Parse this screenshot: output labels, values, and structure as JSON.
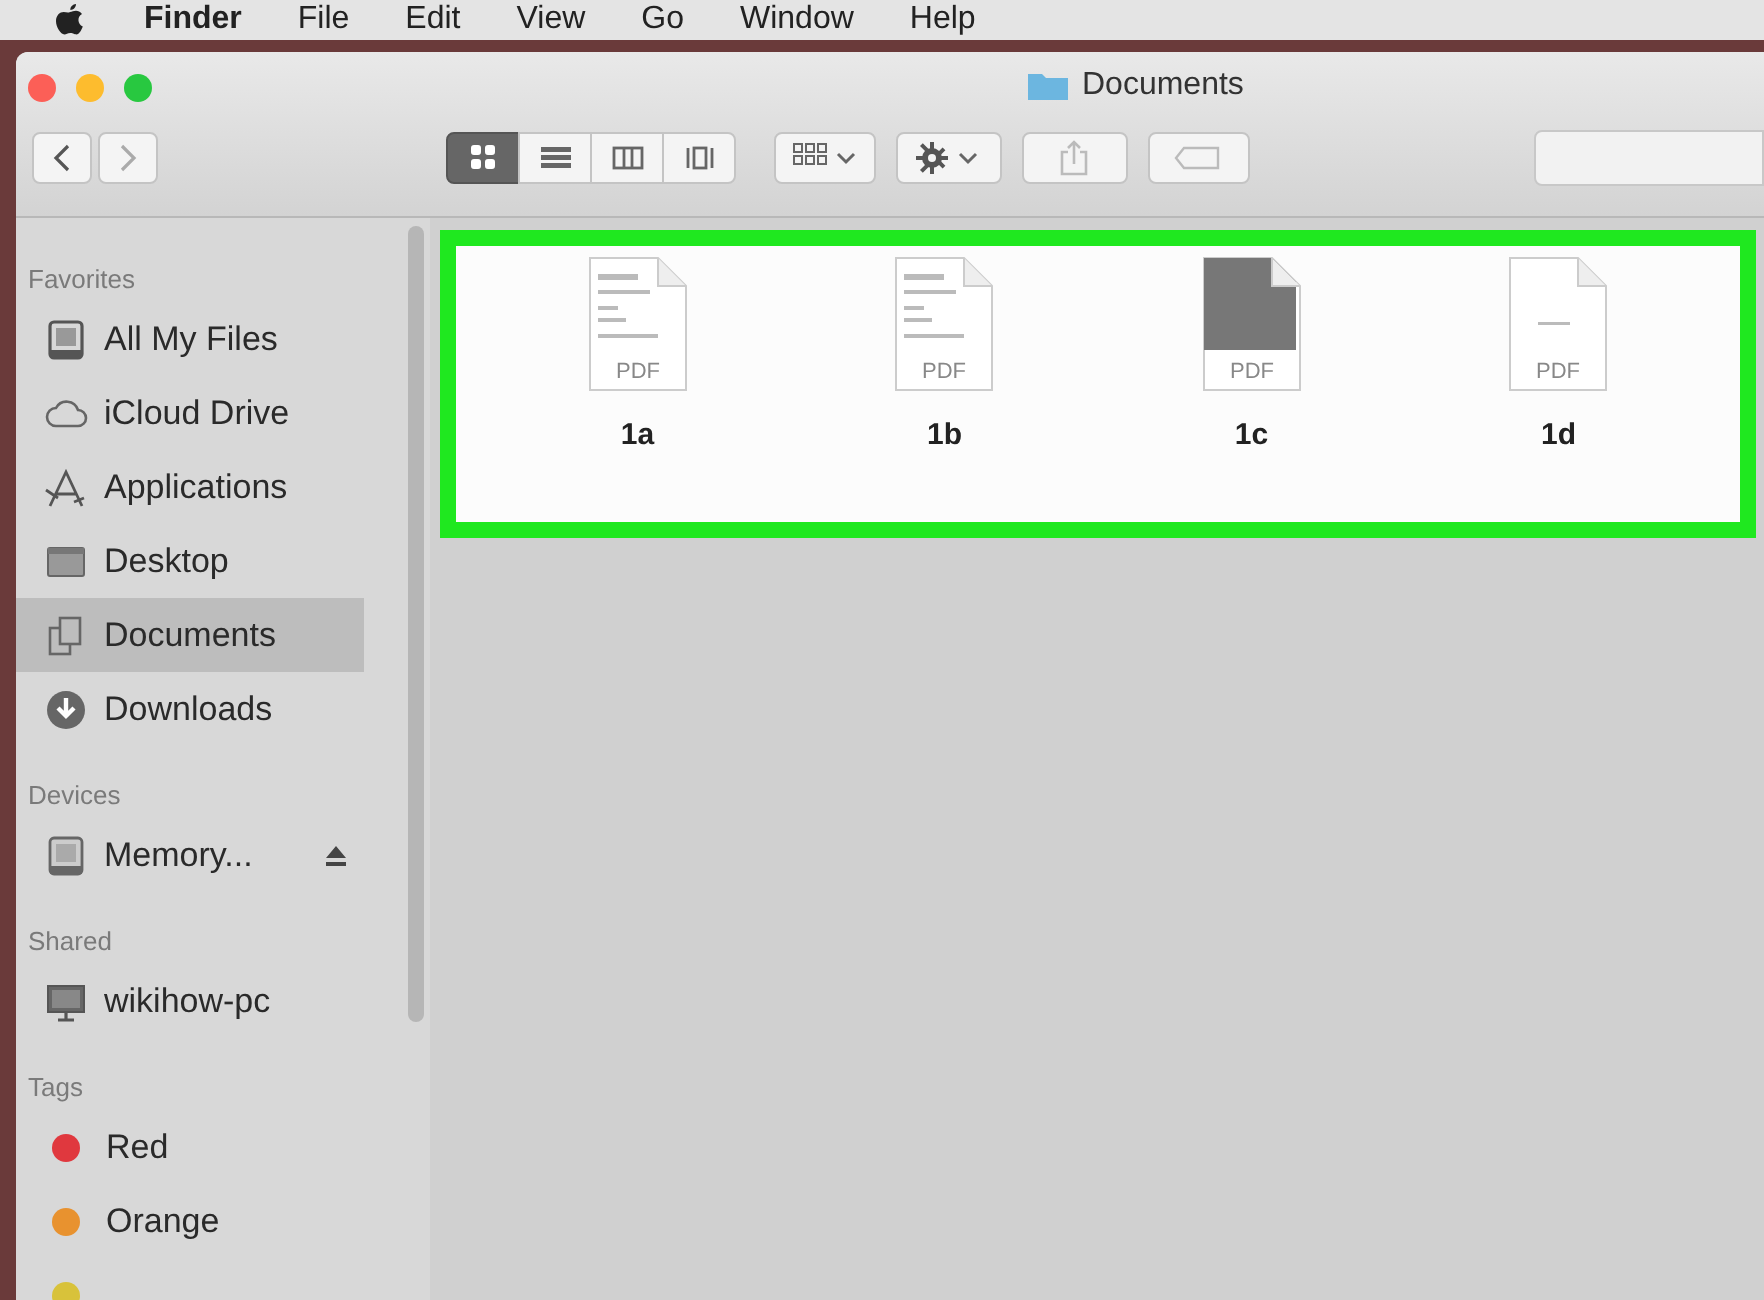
{
  "menu_bar": {
    "items": [
      {
        "label": "Finder",
        "kind": "app"
      },
      {
        "label": "File",
        "kind": "menu"
      },
      {
        "label": "Edit",
        "kind": "menu"
      },
      {
        "label": "View",
        "kind": "menu"
      },
      {
        "label": "Go",
        "kind": "menu"
      },
      {
        "label": "Window",
        "kind": "menu"
      },
      {
        "label": "Help",
        "kind": "menu"
      }
    ]
  },
  "window": {
    "title": "Documents"
  },
  "toolbar": {
    "view_modes": [
      {
        "selected": true
      },
      {
        "selected": false
      },
      {
        "selected": false
      },
      {
        "selected": false
      }
    ]
  },
  "sidebar": {
    "sections": [
      {
        "header": "Favorites",
        "items": [
          {
            "label": "All My Files",
            "selected": false
          },
          {
            "label": "iCloud Drive",
            "selected": false
          },
          {
            "label": "Applications",
            "selected": false
          },
          {
            "label": "Desktop",
            "selected": false
          },
          {
            "label": "Documents",
            "selected": true
          },
          {
            "label": "Downloads",
            "selected": false
          }
        ]
      },
      {
        "header": "Devices",
        "items": [
          {
            "label": "Memory...",
            "selected": false,
            "ejectable": true
          }
        ]
      },
      {
        "header": "Shared",
        "items": [
          {
            "label": "wikihow-pc",
            "selected": false
          }
        ]
      },
      {
        "header": "Tags",
        "items": [
          {
            "label": "Red",
            "selected": false,
            "color": "#e0383e"
          },
          {
            "label": "Orange",
            "selected": false,
            "color": "#e8922f"
          },
          {
            "selected": false,
            "color": "#d8c23a"
          }
        ]
      }
    ]
  },
  "files": [
    {
      "name": "1a",
      "badge": "PDF",
      "kind": "light"
    },
    {
      "name": "1b",
      "badge": "PDF",
      "kind": "light"
    },
    {
      "name": "1c",
      "badge": "PDF",
      "kind": "dark"
    },
    {
      "name": "1d",
      "badge": "PDF",
      "kind": "blank"
    }
  ]
}
